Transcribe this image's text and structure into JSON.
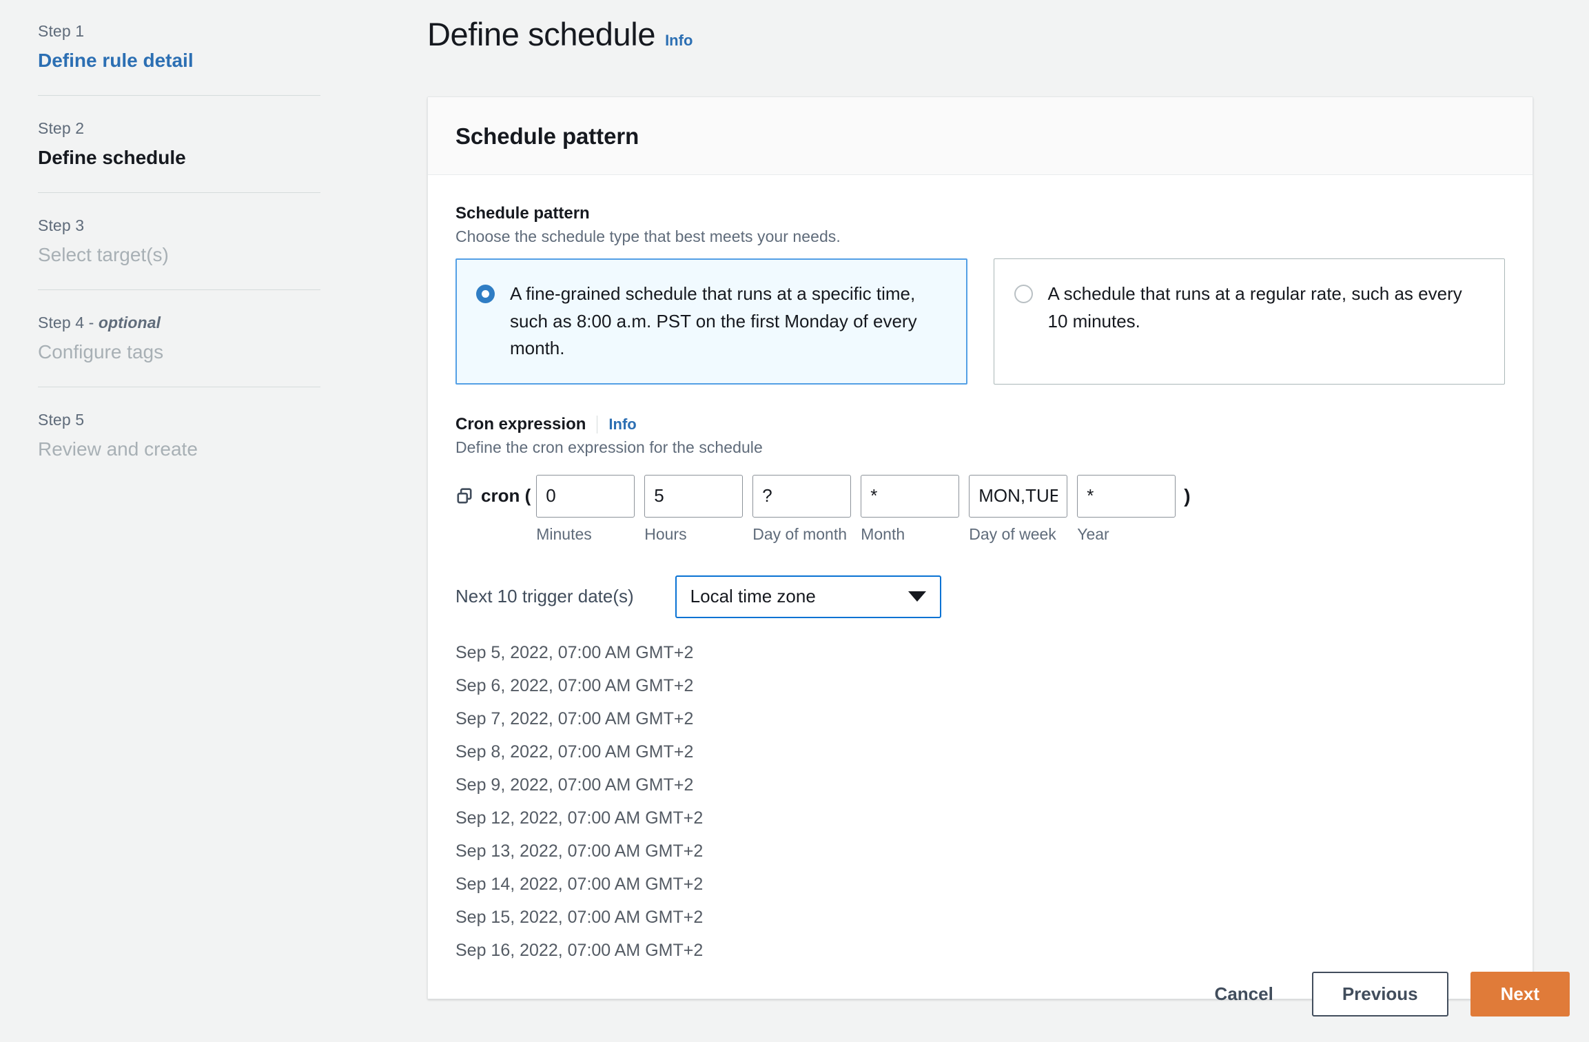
{
  "wizard": {
    "steps": [
      {
        "num": "Step 1",
        "name": "Define rule detail",
        "state": "link"
      },
      {
        "num": "Step 2",
        "name": "Define schedule",
        "state": "current"
      },
      {
        "num": "Step 3",
        "name": "Select target(s)",
        "state": "muted"
      },
      {
        "num": "Step 4 - ",
        "num_em": "optional",
        "name": "Configure tags",
        "state": "muted"
      },
      {
        "num": "Step 5",
        "name": "Review and create",
        "state": "muted"
      }
    ]
  },
  "header": {
    "title": "Define schedule",
    "info_label": "Info"
  },
  "card": {
    "title": "Schedule pattern"
  },
  "schedule_pattern": {
    "label": "Schedule pattern",
    "description": "Choose the schedule type that best meets your needs.",
    "options": [
      {
        "text": "A fine-grained schedule that runs at a specific time, such as 8:00 a.m. PST on the first Monday of every month.",
        "selected": true
      },
      {
        "text": "A schedule that runs at a regular rate, such as every 10 minutes.",
        "selected": false
      }
    ]
  },
  "cron": {
    "label": "Cron expression",
    "info_label": "Info",
    "description": "Define the cron expression for the schedule",
    "prefix_text": "cron (",
    "suffix_text": ")",
    "copy_icon": "copy-icon",
    "fields": [
      {
        "sublabel": "Minutes",
        "value": "0"
      },
      {
        "sublabel": "Hours",
        "value": "5"
      },
      {
        "sublabel": "Day of month",
        "value": "?"
      },
      {
        "sublabel": "Month",
        "value": "*"
      },
      {
        "sublabel": "Day of week",
        "value": "MON,TUE,WED,THU,FRI"
      },
      {
        "sublabel": "Year",
        "value": "*"
      }
    ]
  },
  "trigger": {
    "title": "Next 10 trigger date(s)",
    "timezone_value": "Local time zone",
    "timezone_caret": "chevron-down-icon",
    "dates": [
      "Sep 5, 2022, 07:00 AM GMT+2",
      "Sep 6, 2022, 07:00 AM GMT+2",
      "Sep 7, 2022, 07:00 AM GMT+2",
      "Sep 8, 2022, 07:00 AM GMT+2",
      "Sep 9, 2022, 07:00 AM GMT+2",
      "Sep 12, 2022, 07:00 AM GMT+2",
      "Sep 13, 2022, 07:00 AM GMT+2",
      "Sep 14, 2022, 07:00 AM GMT+2",
      "Sep 15, 2022, 07:00 AM GMT+2",
      "Sep 16, 2022, 07:00 AM GMT+2"
    ]
  },
  "footer": {
    "cancel_label": "Cancel",
    "previous_label": "Previous",
    "next_label": "Next"
  },
  "colors": {
    "accent_link": "#2c6fb3",
    "selected_tile_bg": "#f1faff",
    "selected_tile_border": "#539fe5",
    "focus_border": "#0972d3",
    "primary_button": "#e07b39",
    "page_bg": "#f2f3f3"
  }
}
